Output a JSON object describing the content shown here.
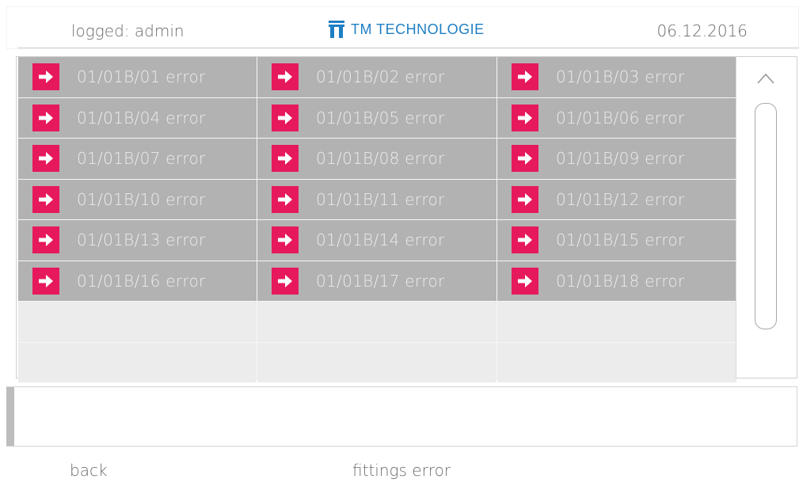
{
  "header": {
    "user_label": "logged: admin",
    "brand_name": "TM TECHNOLOGIE",
    "date": "06.12.2016",
    "brand_color": "#1f7fc4"
  },
  "grid": {
    "items": [
      {
        "label": "01/01B/01 error",
        "icon": "arrow-right-icon"
      },
      {
        "label": "01/01B/02 error",
        "icon": "arrow-right-icon"
      },
      {
        "label": "01/01B/03 error",
        "icon": "arrow-right-icon"
      },
      {
        "label": "01/01B/04 error",
        "icon": "arrow-right-icon"
      },
      {
        "label": "01/01B/05 error",
        "icon": "arrow-right-icon"
      },
      {
        "label": "01/01B/06 error",
        "icon": "arrow-right-icon"
      },
      {
        "label": "01/01B/07 error",
        "icon": "arrow-right-icon"
      },
      {
        "label": "01/01B/08 error",
        "icon": "arrow-right-icon"
      },
      {
        "label": "01/01B/09 error",
        "icon": "arrow-right-icon"
      },
      {
        "label": "01/01B/10 error",
        "icon": "arrow-right-icon"
      },
      {
        "label": "01/01B/11 error",
        "icon": "arrow-right-icon"
      },
      {
        "label": "01/01B/12 error",
        "icon": "arrow-right-icon"
      },
      {
        "label": "01/01B/13 error",
        "icon": "arrow-right-icon"
      },
      {
        "label": "01/01B/14 error",
        "icon": "arrow-right-icon"
      },
      {
        "label": "01/01B/15 error",
        "icon": "arrow-right-icon"
      },
      {
        "label": "01/01B/16 error",
        "icon": "arrow-right-icon"
      },
      {
        "label": "01/01B/17 error",
        "icon": "arrow-right-icon"
      },
      {
        "label": "01/01B/18 error",
        "icon": "arrow-right-icon"
      }
    ],
    "filled_color": "#b2b2b2",
    "empty_color": "#ececec",
    "arrow_color": "#e6195c"
  },
  "scrollbar": {
    "up_icon": "chevron-up-icon"
  },
  "message": {
    "text": ""
  },
  "footer": {
    "back_label": "back",
    "page_title": "fittings error"
  }
}
